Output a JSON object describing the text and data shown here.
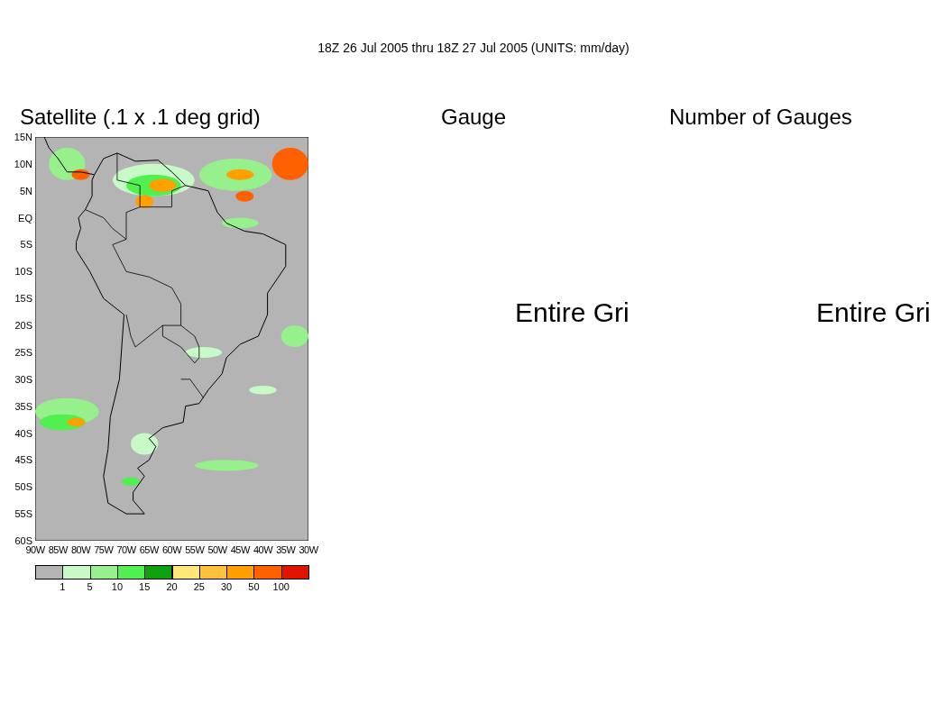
{
  "title": "18Z 26 Jul 2005 thru 18Z 27 Jul 2005 (UNITS: mm/day)",
  "panels": [
    {
      "kind": "map",
      "title": "Satellite (.1 x .1 deg grid)"
    },
    {
      "kind": "message",
      "title": "Gauge",
      "message": "Entire Gri"
    },
    {
      "kind": "message",
      "title": "Number of Gauges",
      "message": "Entire Gri"
    }
  ],
  "map": {
    "lat_labels": [
      "15N",
      "10N",
      "5N",
      "EQ",
      "5S",
      "10S",
      "15S",
      "20S",
      "25S",
      "30S",
      "35S",
      "40S",
      "45S",
      "50S",
      "55S",
      "60S"
    ],
    "lon_labels": [
      "90W",
      "85W",
      "80W",
      "75W",
      "70W",
      "65W",
      "60W",
      "55W",
      "50W",
      "45W",
      "40W",
      "35W",
      "30W"
    ]
  },
  "legend": {
    "swatches": [
      {
        "color": "#b4b4b4"
      },
      {
        "color": "#c8fac8"
      },
      {
        "color": "#96f08c"
      },
      {
        "color": "#50f050"
      },
      {
        "color": "#0fa00f"
      },
      {
        "color": "#ffe678"
      },
      {
        "color": "#ffc03c"
      },
      {
        "color": "#ffa000"
      },
      {
        "color": "#ff6000"
      },
      {
        "color": "#e11400"
      }
    ],
    "labels": [
      "1",
      "5",
      "10",
      "15",
      "20",
      "25",
      "30",
      "50",
      "100"
    ]
  }
}
